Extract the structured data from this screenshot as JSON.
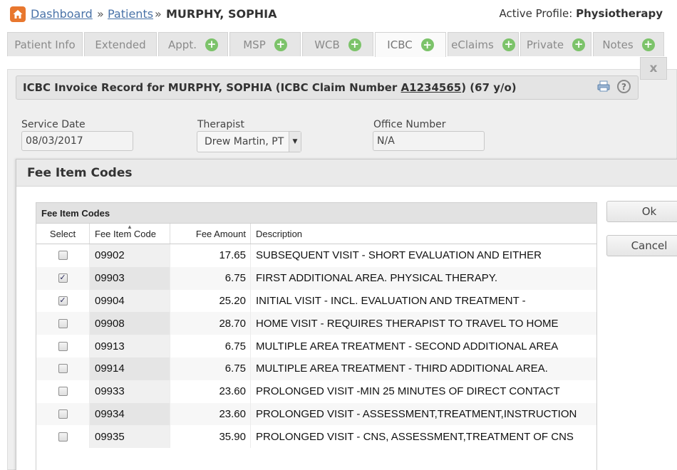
{
  "breadcrumb": {
    "home_icon": "home-icon",
    "dashboard": "Dashboard",
    "sep1": "»",
    "patients": "Patients",
    "sep2": "»",
    "patient_name": "MURPHY, SOPHIA"
  },
  "active_profile": {
    "label": "Active Profile:",
    "value": "Physiotherapy"
  },
  "tabs": [
    {
      "label": "Patient Info",
      "plus": false
    },
    {
      "label": "Extended",
      "plus": false
    },
    {
      "label": "Appt.",
      "plus": true
    },
    {
      "label": "MSP",
      "plus": true
    },
    {
      "label": "WCB",
      "plus": true
    },
    {
      "label": "ICBC",
      "plus": true,
      "active": true
    },
    {
      "label": "eClaims",
      "plus": true
    },
    {
      "label": "Private",
      "plus": true
    },
    {
      "label": "Notes",
      "plus": true
    }
  ],
  "panel": {
    "close": "x",
    "record_title_prefix": "ICBC Invoice Record for MURPHY, SOPHIA (ICBC Claim Number ",
    "claim_number": "A1234565",
    "record_title_suffix": ") (67 y/o)",
    "service_date_label": "Service Date",
    "service_date": "08/03/2017",
    "therapist_label": "Therapist",
    "therapist": "Drew Martin, PT",
    "office_label": "Office Number",
    "office": "N/A"
  },
  "modal": {
    "title": "Fee Item Codes",
    "grid_caption": "Fee Item Codes",
    "columns": {
      "select": "Select",
      "code": "Fee Item Code",
      "amount": "Fee Amount",
      "description": "Description"
    },
    "rows": [
      {
        "checked": false,
        "code": "09902",
        "amount": "17.65",
        "description": "SUBSEQUENT VISIT - SHORT EVALUATION AND EITHER"
      },
      {
        "checked": true,
        "code": "09903",
        "amount": "6.75",
        "description": "FIRST ADDITIONAL AREA. PHYSICAL THERAPY."
      },
      {
        "checked": true,
        "code": "09904",
        "amount": "25.20",
        "description": "INITIAL VISIT - INCL. EVALUATION AND TREATMENT -"
      },
      {
        "checked": false,
        "code": "09908",
        "amount": "28.70",
        "description": "HOME VISIT - REQUIRES THERAPIST TO TRAVEL TO HOME"
      },
      {
        "checked": false,
        "code": "09913",
        "amount": "6.75",
        "description": "MULTIPLE AREA TREATMENT - SECOND ADDITIONAL AREA"
      },
      {
        "checked": false,
        "code": "09914",
        "amount": "6.75",
        "description": "MULTIPLE AREA TREATMENT - THIRD ADDITIONAL AREA."
      },
      {
        "checked": false,
        "code": "09933",
        "amount": "23.60",
        "description": "PROLONGED VISIT -MIN 25 MINUTES OF DIRECT CONTACT"
      },
      {
        "checked": false,
        "code": "09934",
        "amount": "23.60",
        "description": "PROLONGED VISIT - ASSESSMENT,TREATMENT,INSTRUCTION"
      },
      {
        "checked": false,
        "code": "09935",
        "amount": "35.90",
        "description": "PROLONGED VISIT - CNS, ASSESSMENT,TREATMENT OF CNS"
      }
    ],
    "ok_label": "Ok",
    "cancel_label": "Cancel"
  }
}
